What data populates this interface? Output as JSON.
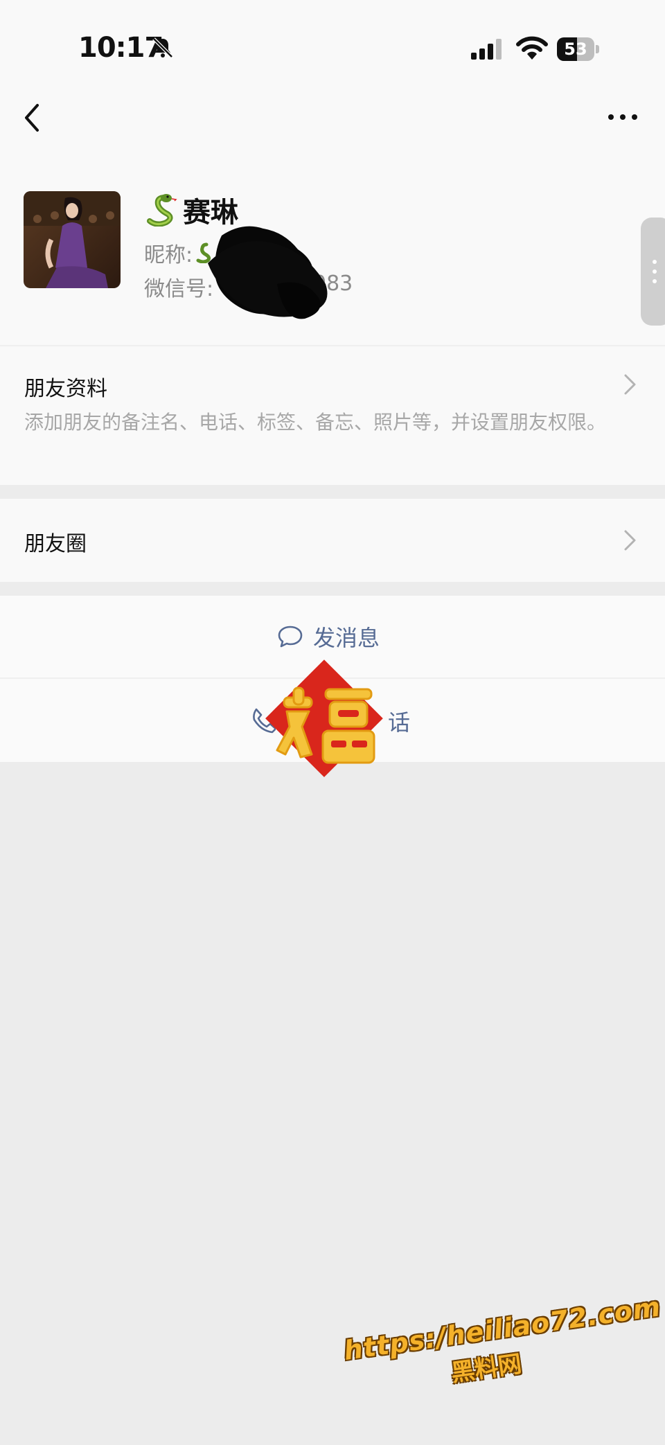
{
  "status_bar": {
    "time": "10:17",
    "battery_level": "53",
    "battery_fill_fraction": 0.53,
    "icons": [
      "bell-muted-icon",
      "signal-icon",
      "wifi-icon",
      "battery-icon"
    ]
  },
  "nav": {
    "back_icon": "chevron-left-icon",
    "more_icon": "more-dots-icon"
  },
  "profile": {
    "name": "赛琳",
    "name_emoji_icon": "snake-icon",
    "nickname_label": "昵称:",
    "wechat_id_label": "微信号:",
    "wechat_id_visible_suffix": "083"
  },
  "friend_info": {
    "title": "朋友资料",
    "description": "添加朋友的备注名、电话、标签、备忘、照片等，并设置朋友权限。"
  },
  "moments": {
    "title": "朋友圈"
  },
  "actions": {
    "send_message": "发消息",
    "call_visible": "话"
  },
  "watermark": {
    "url": "https:/heiliao72.com",
    "name": "黑料网"
  },
  "colors": {
    "link": "#566b94",
    "background": "#ececec",
    "card": "#f9f9f9",
    "sticker_red": "#d9261c",
    "sticker_gold": "#f5c33b"
  }
}
